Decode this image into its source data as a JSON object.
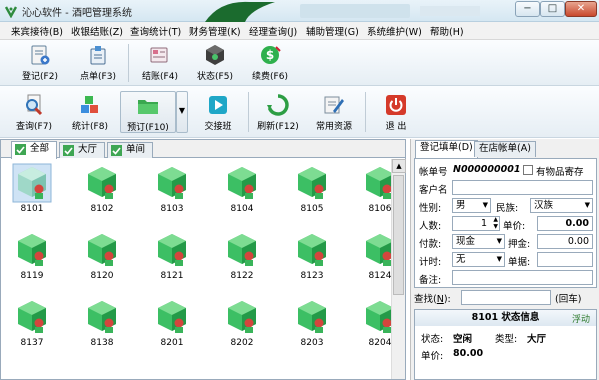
{
  "window": {
    "title": "沁心软件 - 酒吧管理系统",
    "buttons": {
      "minimize": "−",
      "maximize": "□",
      "close": "✕"
    }
  },
  "menu": [
    "来宾接待(B)",
    "收银结账(Z)",
    "查询统计(T)",
    "财务管理(K)",
    "经理查询(J)",
    "辅助管理(G)",
    "系统维护(W)",
    "帮助(H)"
  ],
  "toolbar1": {
    "register": "登记(F2)",
    "order": "点单(F3)",
    "checkout": "结账(F4)",
    "status": "状态(F5)",
    "renew": "续费(F6)"
  },
  "toolbar2": {
    "query": "查询(F7)",
    "stats": "统计(F8)",
    "reserve": "预订(F10)",
    "shift": "交接班",
    "refresh": "刷新(F12)",
    "resources": "常用资源",
    "exit": "退 出"
  },
  "tabs": [
    "全部",
    "大厅",
    "单间"
  ],
  "rooms": [
    "8101",
    "8102",
    "8103",
    "8104",
    "8105",
    "8106",
    "8119",
    "8120",
    "8121",
    "8122",
    "8123",
    "8124",
    "8137",
    "8138",
    "8201",
    "8202",
    "8203",
    "8204"
  ],
  "right": {
    "tabs": [
      "登记填单(D)",
      "在店帐单(A)"
    ],
    "form": {
      "bill_no_label": "帐单号",
      "bill_no": "N000000001",
      "goods_label": "有物品寄存",
      "customer_label": "客户名",
      "customer": "",
      "gender_label": "性别:",
      "gender": "男",
      "ethnicity_label": "民族:",
      "ethnicity": "汉族",
      "people_label": "人数:",
      "people": "1",
      "price_label": "单价:",
      "price": "0.00",
      "payment_label": "付款:",
      "payment": "现金",
      "deposit_label": "押金:",
      "deposit": "0.00",
      "timing_label": "计时:",
      "timing": "无",
      "voucher_label": "单据:",
      "voucher": "",
      "remark_label": "备注:",
      "remark": ""
    },
    "search": {
      "label": "查找(",
      "label2": "N):",
      "hint": "(回车)"
    },
    "status": {
      "title": "8101 状态信息",
      "float": "浮动",
      "state_label": "状态:",
      "state": "空闲",
      "type_label": "类型:",
      "type": "大厅",
      "price_label": "单价:",
      "price": "80.00"
    }
  },
  "colors": {
    "accent": "#1f7a34",
    "cube_green": "#3cbf64",
    "cube_dark": "#249a48",
    "dot_red": "#d4453d",
    "exit_red": "#d53a2a"
  }
}
